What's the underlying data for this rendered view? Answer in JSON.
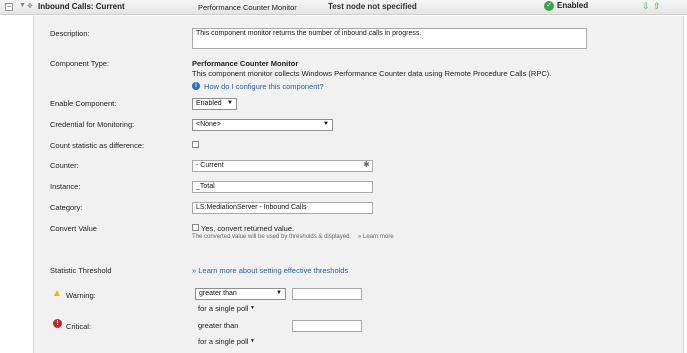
{
  "header": {
    "title": "Inbound Calls: Current",
    "monitor_type": "Performance Counter Monitor",
    "test_node": "Test node not specified",
    "status": "Enabled"
  },
  "form": {
    "description": {
      "label": "Description:",
      "value": "This component monitor returns the number of inbound calls in progress."
    },
    "component_type": {
      "label": "Component Type:",
      "name": "Performance Counter Monitor",
      "desc": "This component monitor collects Windows Performance Counter data using Remote Procedure Calls (RPC).",
      "help_link": "How do I configure this component?"
    },
    "enable_component": {
      "label": "Enable Component:",
      "value": "Enabled"
    },
    "credential": {
      "label": "Credential for Monitoring:",
      "value": "<None>"
    },
    "count_difference": {
      "label": "Count statistic as difference:"
    },
    "counter": {
      "label": "Counter:",
      "value": "- Current"
    },
    "instance": {
      "label": "Instance:",
      "value": "_Total"
    },
    "category": {
      "label": "Category:",
      "value": "LS:MediationServer - Inbound Calls"
    },
    "convert_value": {
      "label": "Convert Value",
      "checkbox_label": "Yes, convert returned value.",
      "note": "The converted value will be used by thresholds & displayed.",
      "learn_more": "» Learn more"
    },
    "statistic_threshold": {
      "label": "Statistic Threshold",
      "link": "» Learn more about setting effective thresholds"
    },
    "warning": {
      "label": "Warning:",
      "operator": "greater than",
      "poll": "for  a single poll"
    },
    "critical": {
      "label": "Critical:",
      "operator": "greater than",
      "poll": "for  a single poll"
    }
  },
  "colors": {
    "warning": "#f0b400",
    "critical": "#c0282c",
    "enabled": "#3aa64a",
    "link": "#2a5db0"
  }
}
